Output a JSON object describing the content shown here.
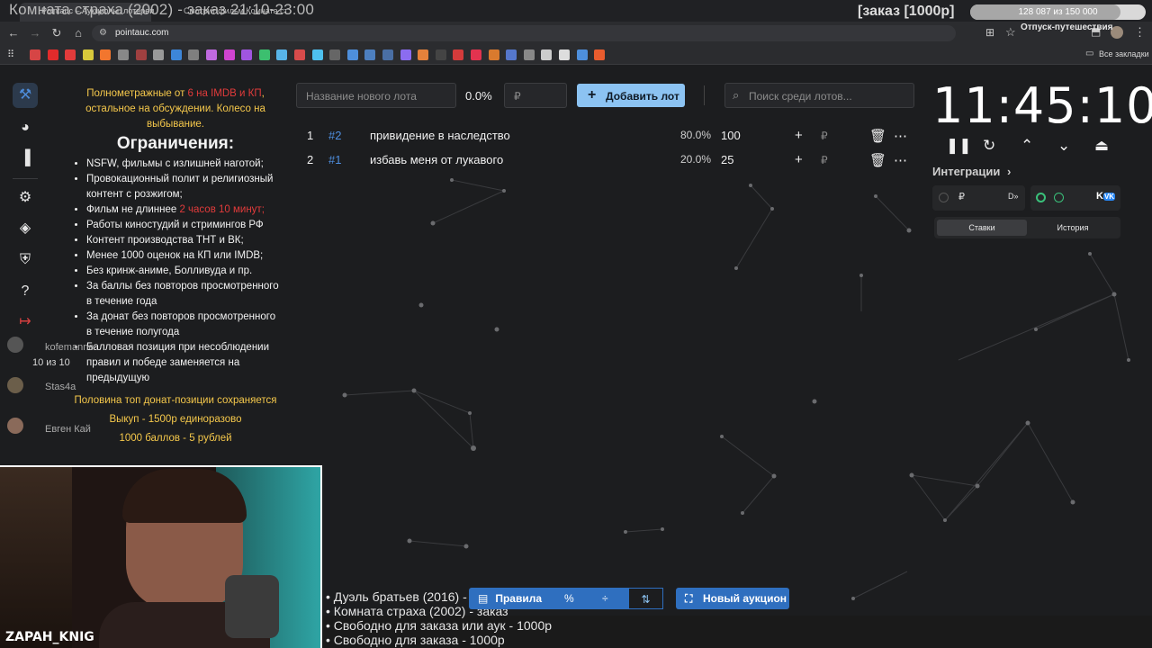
{
  "browser": {
    "tabs": [
      "Pointauc – Аукционы, лотереи",
      "Смотрит фильм Комната ст"
    ],
    "url": "pointauc.com",
    "bookmarks_folder": "Все закладки",
    "bookmark_colors": [
      "#d64545",
      "#e22b2b",
      "#e23b3b",
      "#d7c93b",
      "#f2762e",
      "#888888",
      "#a04040",
      "#999999",
      "#3d86d8",
      "#7f7f7f",
      "#c06ae0",
      "#d044d0",
      "#a055e0",
      "#3cbf6f",
      "#58b4e8",
      "#d84b4b",
      "#4ec1f0",
      "#666666",
      "#4e8fdc",
      "#4d7fbf",
      "#4a6fa5",
      "#8b6cf0",
      "#e5813b",
      "#444444",
      "#d43b3b",
      "#e2334f",
      "#d97a2e",
      "#5577cc",
      "#888888",
      "#cccccc",
      "#dddddd",
      "#4e8fdc",
      "#e85c2e"
    ]
  },
  "stream": {
    "title": "Комната страха (2002) - заказ 21:10-23:00",
    "order_badge": "[заказ [1000р]",
    "progress_text": "128 087 из 150 000",
    "progress_ratio": 0.854,
    "progress_sub": "Отпуск-путешествия"
  },
  "rules": {
    "intro_1": "Полнометражные от ",
    "intro_red": "6 на IMDB и КП",
    "intro_2": ", остальное на обсуждении. Колесо на выбывание.",
    "heading": "Ограничения:",
    "items": [
      "NSFW, фильмы с излишней наготой;",
      "Провокационный полит и религиозный контент с розжигом;",
      "Фильм не длиннее ",
      "Работы киностудий и стримингов РФ",
      "Контент производства ТНТ и ВК;",
      "Менее 1000 оценок на КП или IMDB;",
      "Без кринж-аниме, Болливуда и пр.",
      "За баллы без повторов просмотренного в течение года",
      "За донат без повторов просмотренного в течение полугода",
      "Балловая позиция при несоблюдении правил и победе заменяется на предыдущую"
    ],
    "length_red": "2 часов 10 минут",
    "footer_1": "Половина топ донат-позиции сохраняется",
    "footer_2": "Выкуп - 1500р единоразово",
    "footer_3": "1000 баллов - 5 рублей"
  },
  "chat": {
    "user1": "kofemanne",
    "count": "10 из 10",
    "user2": "Stas4a",
    "user3": "Евген Кай"
  },
  "lot_form": {
    "name_placeholder": "Название нового лота",
    "percent": "0.0%",
    "currency": "₽",
    "add_label": "Добавить лот",
    "search_placeholder": "Поиск среди лотов..."
  },
  "lots": [
    {
      "num": "1",
      "id": "#2",
      "name": "привидение в наследство",
      "percent": "80.0%",
      "amount": "100"
    },
    {
      "num": "2",
      "id": "#1",
      "name": "избавь меня от лукавого",
      "percent": "20.0%",
      "amount": "25"
    }
  ],
  "timer": {
    "time": "11:45:10",
    "integrations_label": "Интеграции",
    "tab_bets": "Ставки",
    "tab_history": "История"
  },
  "bottom": {
    "rules_label": "Правила",
    "new_auction": "Новый аукцион",
    "ticker": [
      "• Дуэль братьев (2016) - аук",
      "• Комната страха (2002) - заказ",
      "• Свободно для заказа или аук - 1000р",
      "• Свободно для заказа - 1000р"
    ]
  },
  "webcam": {
    "name": "ZAPAH_KNIG"
  }
}
